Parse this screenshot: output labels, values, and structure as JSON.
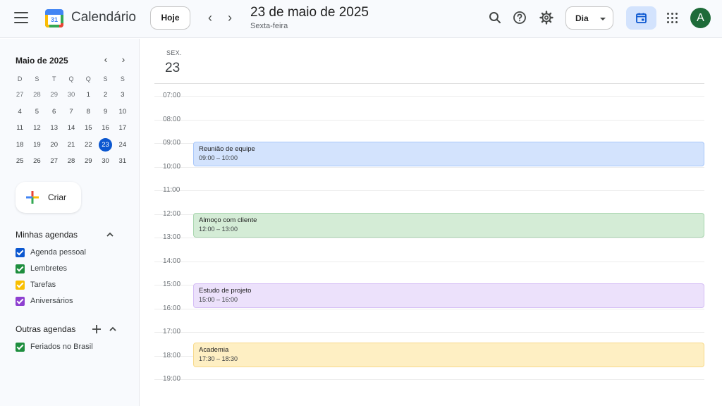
{
  "header": {
    "app_title": "Calendário",
    "today_label": "Hoje",
    "date_title": "23 de maio de 2025",
    "weekday": "Sexta-feira",
    "view_label": "Dia",
    "avatar_letter": "A"
  },
  "mini_calendar": {
    "month_title": "Maio de 2025",
    "weekday_heads": [
      "D",
      "S",
      "T",
      "Q",
      "Q",
      "S",
      "S"
    ],
    "weeks": [
      [
        "27",
        "28",
        "29",
        "30",
        "1",
        "2",
        "3"
      ],
      [
        "4",
        "5",
        "6",
        "7",
        "8",
        "9",
        "10"
      ],
      [
        "11",
        "12",
        "13",
        "14",
        "15",
        "16",
        "17"
      ],
      [
        "18",
        "19",
        "20",
        "21",
        "22",
        "23",
        "24"
      ],
      [
        "25",
        "26",
        "27",
        "28",
        "29",
        "30",
        "31"
      ]
    ],
    "selected": "23"
  },
  "sidebar": {
    "create_label": "Criar",
    "my_calendars_title": "Minhas agendas",
    "my_calendars": [
      {
        "name": "Agenda pessoal",
        "color": "#0b57d0"
      },
      {
        "name": "Lembretes",
        "color": "#1e8e3e"
      },
      {
        "name": "Tarefas",
        "color": "#f9bf00"
      },
      {
        "name": "Aniversários",
        "color": "#8e3fd0"
      }
    ],
    "other_calendars_title": "Outras agendas",
    "other_calendars": [
      {
        "name": "Feriados no Brasil",
        "color": "#1e8e3e"
      }
    ]
  },
  "day_view": {
    "day_abbrev": "SEX.",
    "day_number": "23",
    "hours": [
      "07:00",
      "08:00",
      "09:00",
      "10:00",
      "11:00",
      "12:00",
      "13:00",
      "14:00",
      "15:00",
      "16:00",
      "17:00",
      "18:00",
      "19:00"
    ],
    "events": [
      {
        "title": "Reunião de equipe",
        "time": "09:00 – 10:00",
        "bg": "#d3e3fd",
        "border": "#a8c7fa"
      },
      {
        "title": "Almoço com cliente",
        "time": "12:00 – 13:00",
        "bg": "#d4ecd6",
        "border": "#a8d5ae"
      },
      {
        "title": "Estudo de projeto",
        "time": "15:00 – 16:00",
        "bg": "#ece1fb",
        "border": "#d4bdf5"
      },
      {
        "title": "Academia",
        "time": "17:30 – 18:30",
        "bg": "#feefc3",
        "border": "#f7d98a"
      }
    ]
  }
}
